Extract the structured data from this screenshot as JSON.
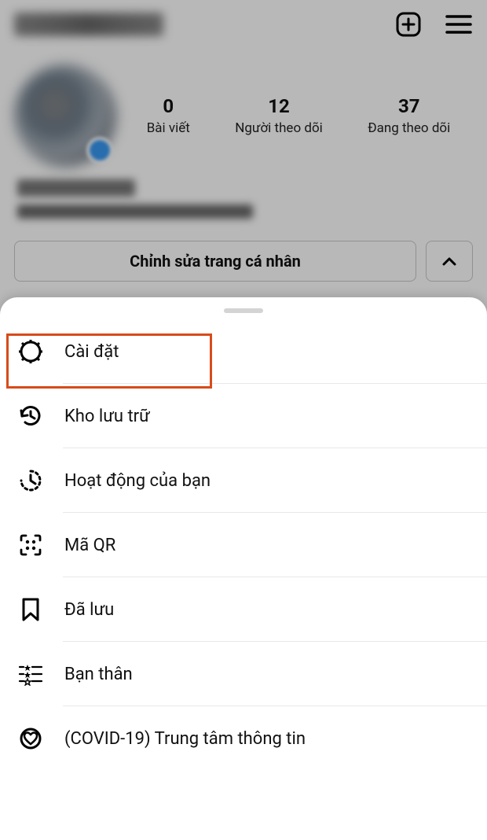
{
  "header": {
    "create_icon": "plus-square-icon",
    "menu_icon": "hamburger-icon"
  },
  "stats": {
    "posts": {
      "count": "0",
      "label": "Bài viết"
    },
    "followers": {
      "count": "12",
      "label": "Người theo dõi"
    },
    "following": {
      "count": "37",
      "label": "Đang theo dõi"
    }
  },
  "buttons": {
    "edit_profile": "Chỉnh sửa trang cá nhân"
  },
  "sheet": {
    "items": [
      {
        "icon": "gear-icon",
        "label": "Cài đặt",
        "highlighted": true
      },
      {
        "icon": "history-icon",
        "label": "Kho lưu trữ"
      },
      {
        "icon": "activity-icon",
        "label": "Hoạt động của bạn"
      },
      {
        "icon": "qr-icon",
        "label": "Mã QR"
      },
      {
        "icon": "bookmark-icon",
        "label": "Đã lưu"
      },
      {
        "icon": "close-friends-icon",
        "label": "Bạn thân"
      },
      {
        "icon": "covid-icon",
        "label": "(COVID-19) Trung tâm thông tin"
      }
    ]
  }
}
